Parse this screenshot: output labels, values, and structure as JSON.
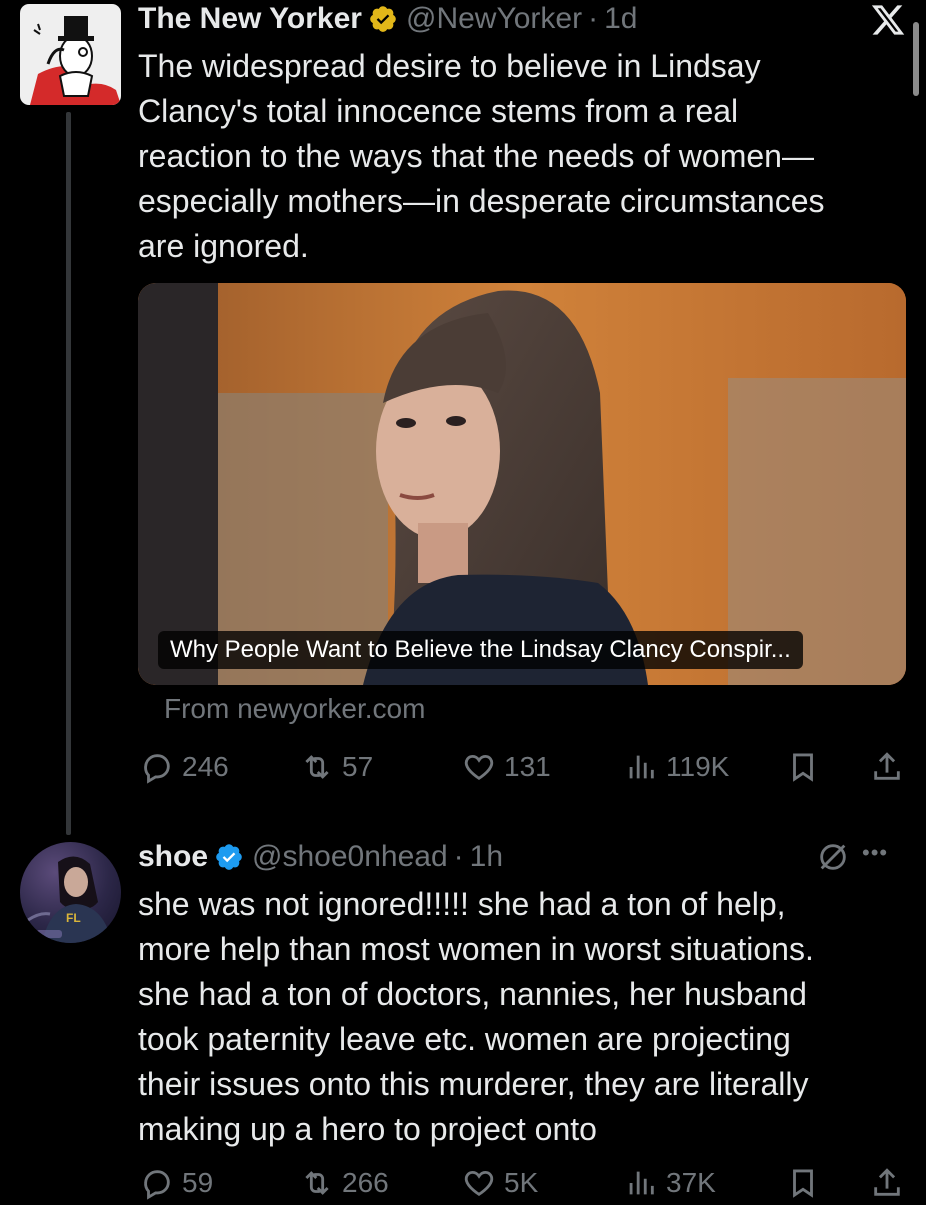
{
  "tweet1": {
    "display_name": "The New Yorker",
    "handle": "@NewYorker",
    "separator": "·",
    "time": "1d",
    "text": "The widespread desire to believe in Lindsay\nClancy's total innocence stems from a real\nreaction to the ways that the needs of women—\nespecially mothers—in desperate circumstances\nare ignored.",
    "card_caption": "Why People Want to Believe the Lindsay Clancy Conspir...",
    "card_source": "From newyorker.com",
    "actions": {
      "replies": "246",
      "retweets": "57",
      "likes": "131",
      "views": "119K"
    }
  },
  "tweet2": {
    "display_name": "shoe",
    "handle": "@shoe0nhead",
    "separator": "·",
    "time": "1h",
    "more_icon": "•••",
    "text": "she was not ignored!!!!! she had a ton of help,\nmore help than most women in worst situations.\nshe had a ton of doctors, nannies, her husband\ntook paternity leave etc. women are projecting\ntheir issues onto this murderer, they are literally\nmaking up a hero to project onto",
    "actions": {
      "replies": "59",
      "retweets": "266",
      "likes": "5K",
      "views": "37K"
    }
  },
  "colors": {
    "background": "#000000",
    "text": "#e7e9ea",
    "muted": "#71767b",
    "verified_blue": "#1d9bf0",
    "verified_gold": "#e2b719"
  },
  "icons": [
    "x-logo",
    "reply-icon",
    "retweet-icon",
    "like-icon",
    "views-icon",
    "bookmark-icon",
    "share-icon",
    "grok-icon",
    "more-icon",
    "verified-badge"
  ]
}
